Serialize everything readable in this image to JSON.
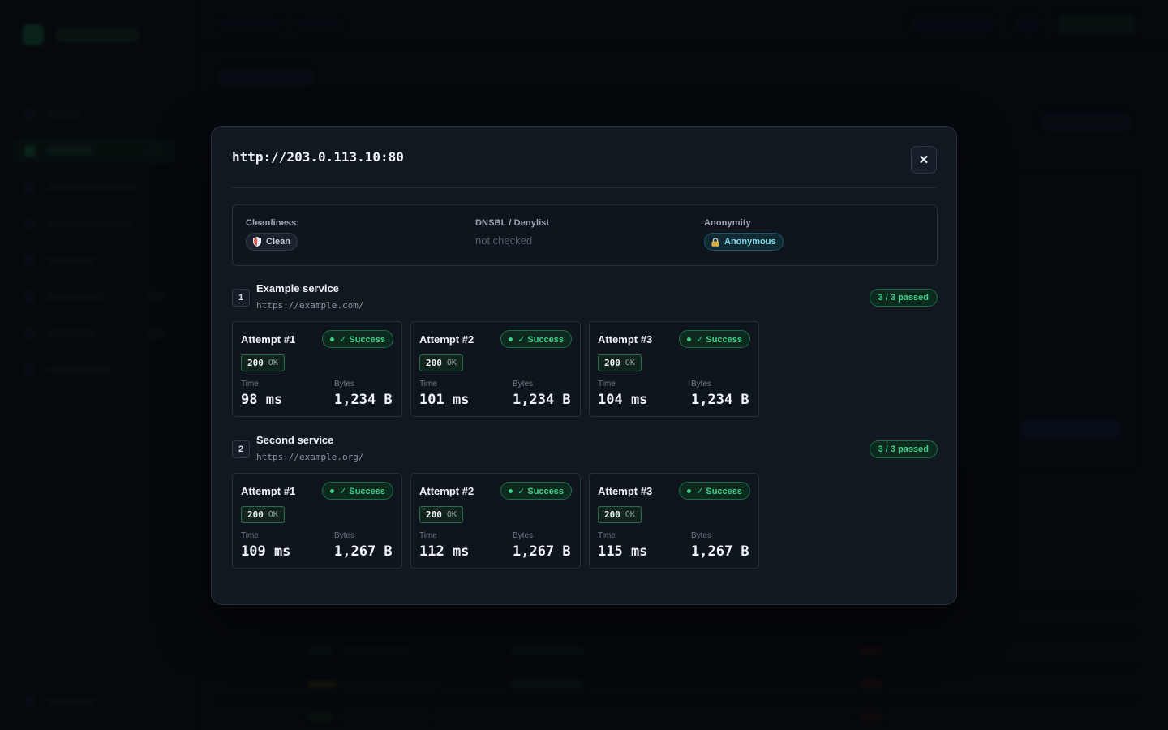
{
  "modal": {
    "title": "http://203.0.113.10:80",
    "close_label": "✕",
    "info": {
      "cleanliness": {
        "label": "Cleanliness:",
        "value": "Clean"
      },
      "dnsbl": {
        "label": "DNSBL / Denylist",
        "value": "not checked"
      },
      "anonymity": {
        "label": "Anonymity",
        "value": "Anonymous"
      }
    },
    "services": [
      {
        "number": "1",
        "name": "Example service",
        "url": "https://example.com/",
        "passed": "3 / 3 passed",
        "attempts": [
          {
            "title": "Attempt #1",
            "status": "✓ Success",
            "code": "200",
            "code_text": "OK",
            "time_label": "Time",
            "time": "98 ms",
            "bytes_label": "Bytes",
            "bytes": "1,234 B"
          },
          {
            "title": "Attempt #2",
            "status": "✓ Success",
            "code": "200",
            "code_text": "OK",
            "time_label": "Time",
            "time": "101 ms",
            "bytes_label": "Bytes",
            "bytes": "1,234 B"
          },
          {
            "title": "Attempt #3",
            "status": "✓ Success",
            "code": "200",
            "code_text": "OK",
            "time_label": "Time",
            "time": "104 ms",
            "bytes_label": "Bytes",
            "bytes": "1,234 B"
          }
        ]
      },
      {
        "number": "2",
        "name": "Second service",
        "url": "https://example.org/",
        "passed": "3 / 3 passed",
        "attempts": [
          {
            "title": "Attempt #1",
            "status": "✓ Success",
            "code": "200",
            "code_text": "OK",
            "time_label": "Time",
            "time": "109 ms",
            "bytes_label": "Bytes",
            "bytes": "1,267 B"
          },
          {
            "title": "Attempt #2",
            "status": "✓ Success",
            "code": "200",
            "code_text": "OK",
            "time_label": "Time",
            "time": "112 ms",
            "bytes_label": "Bytes",
            "bytes": "1,267 B"
          },
          {
            "title": "Attempt #3",
            "status": "✓ Success",
            "code": "200",
            "code_text": "OK",
            "time_label": "Time",
            "time": "115 ms",
            "bytes_label": "Bytes",
            "bytes": "1,267 B"
          }
        ]
      }
    ]
  },
  "colors": {
    "success": "#3fd08a",
    "accent_cyan": "#7fd8ea",
    "modal_bg": "#111820"
  },
  "icons": {
    "close": "close-icon",
    "cleanliness": "shield-icon",
    "anonymity": "lock-icon",
    "status": "status-dot-icon"
  }
}
